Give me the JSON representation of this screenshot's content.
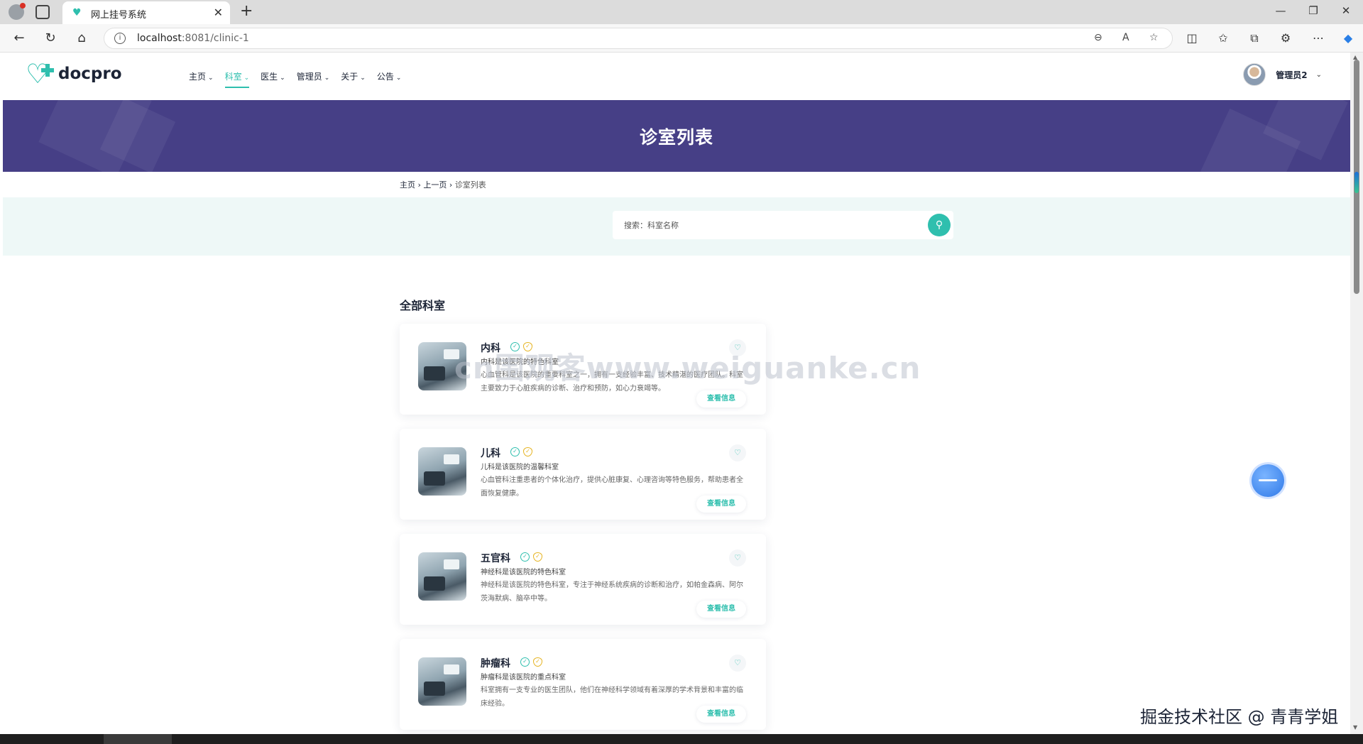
{
  "browser": {
    "tab_title": "网上挂号系统",
    "url_host": "localhost",
    "url_path": ":8081/clinic-1",
    "tab_close": "✕",
    "new_tab": "+"
  },
  "header": {
    "logo_text": "docpro",
    "nav": [
      {
        "label": "主页",
        "active": false
      },
      {
        "label": "科室",
        "active": true
      },
      {
        "label": "医生",
        "active": false
      },
      {
        "label": "管理员",
        "active": false
      },
      {
        "label": "关于",
        "active": false
      },
      {
        "label": "公告",
        "active": false
      }
    ],
    "user_name": "管理员2"
  },
  "banner": {
    "title": "诊室列表"
  },
  "breadcrumb": {
    "home": "主页",
    "prev": "上一页",
    "current": "诊室列表",
    "sep": "›"
  },
  "search": {
    "placeholder": "搜索：科室名称"
  },
  "section": {
    "title": "全部科室"
  },
  "cards": [
    {
      "name": "内科",
      "subtitle": "内科是该医院的特色科室",
      "desc": "心血管科是该医院的重要科室之一，拥有一支经验丰富、技术精湛的医疗团队。科室主要致力于心脏疾病的诊断、治疗和预防，如心力衰竭等。",
      "button": "查看信息"
    },
    {
      "name": "儿科",
      "subtitle": "儿科是该医院的温馨科室",
      "desc": "心血管科注重患者的个体化治疗，提供心脏康复、心理咨询等特色服务，帮助患者全面恢复健康。",
      "button": "查看信息"
    },
    {
      "name": "五官科",
      "subtitle": "神经科是该医院的特色科室",
      "desc": "神经科是该医院的特色科室，专注于神经系统疾病的诊断和治疗，如帕金森病、阿尔茨海默病、脑卒中等。",
      "button": "查看信息"
    },
    {
      "name": "肿瘤科",
      "subtitle": "肿瘤科是该医院的重点科室",
      "desc": "科室拥有一支专业的医生团队，他们在神经科学领域有着深厚的学术背景和丰富的临床经验。",
      "button": "查看信息"
    }
  ],
  "watermarks": {
    "center": "cn围观客www.weiguanke.cn",
    "corner": "掘金技术社区 @ 青青学姐"
  },
  "icons": {
    "back": "←",
    "reload": "↻",
    "home": "⌂",
    "info": "i",
    "search": "⚲",
    "heart": "♡",
    "check": "✓",
    "shield": "✓",
    "chevron": "⌄",
    "more": "⋯"
  },
  "colors": {
    "accent": "#2fbfae",
    "banner": "#463f86",
    "search_band": "#eef8f7",
    "badge_gold": "#e6b422"
  }
}
